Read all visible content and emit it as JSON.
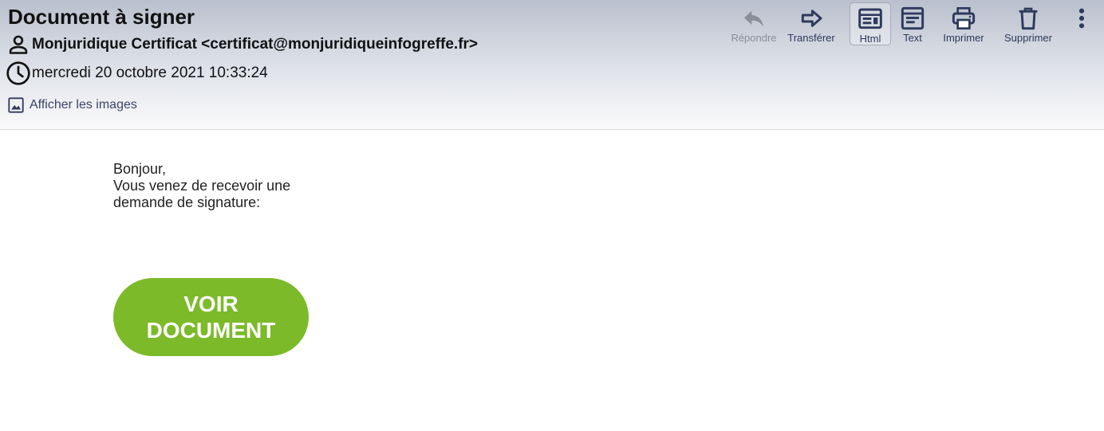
{
  "message": {
    "subject": "Document à signer",
    "sender": "Monjuridique Certificat <certificat@monjuridiqueinfogreffe.fr>",
    "date": "mercredi 20 octobre 2021 10:33:24",
    "show_images_label": "Afficher les images"
  },
  "toolbar": {
    "reply_label": "Répondre",
    "forward_label": "Transférer",
    "html_label": "Html",
    "text_label": "Text",
    "print_label": "Imprimer",
    "delete_label": "Supprimer",
    "active_view": "Html"
  },
  "body": {
    "greeting": "Bonjour,",
    "line1": "Vous venez de recevoir une",
    "line2": "demande de signature:",
    "cta_line1": "VOIR",
    "cta_line2": "DOCUMENT"
  },
  "colors": {
    "accent": "#2e3a5c",
    "cta_background": "#7cba2a",
    "disabled": "#8a8e98"
  },
  "icons": [
    "person-icon",
    "clock-icon",
    "image-icon",
    "reply-icon",
    "forward-icon",
    "html-view-icon",
    "text-view-icon",
    "print-icon",
    "trash-icon",
    "more-vertical-icon"
  ]
}
